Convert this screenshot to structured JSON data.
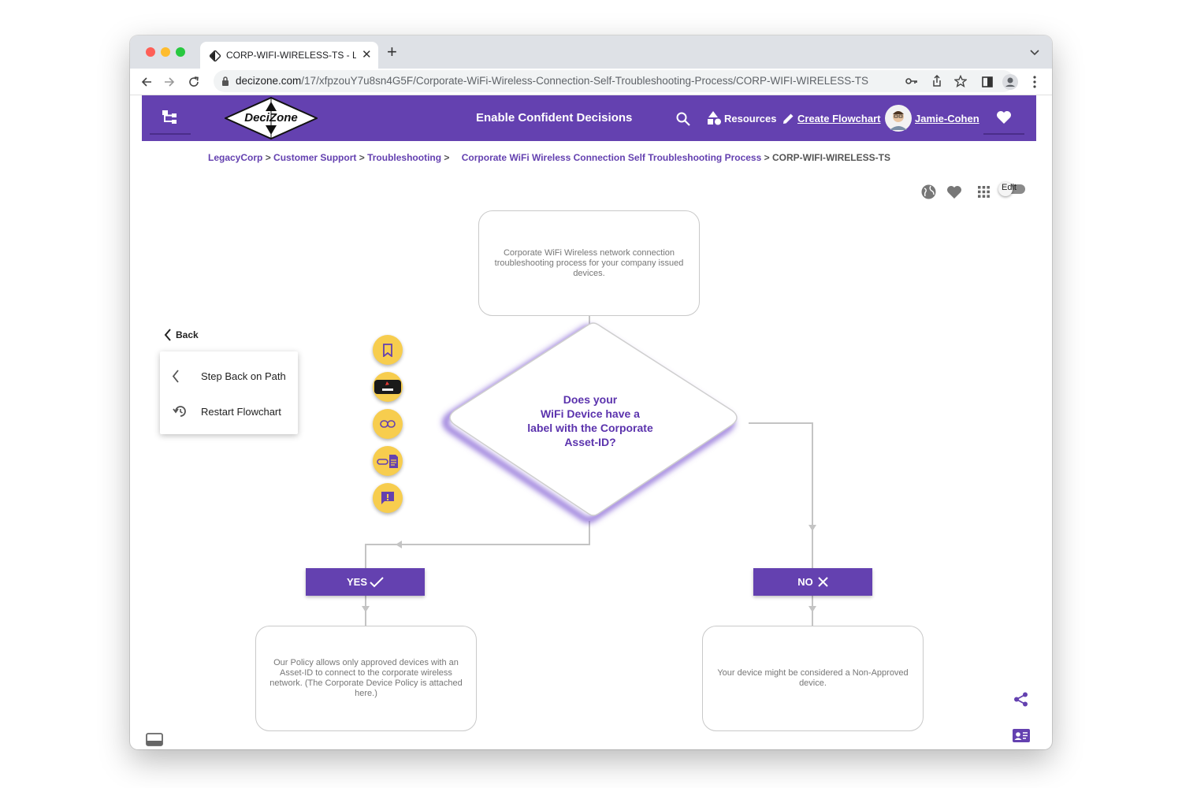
{
  "browser": {
    "tab_title": "CORP-WIFI-WIRELESS-TS - LegacyCorp",
    "url_domain": "decizone.com",
    "url_path": "/17/xfpzouY7u8sn4G5F/Corporate-WiFi-Wireless-Connection-Self-Troubleshooting-Process/CORP-WIFI-WIRELESS-TS",
    "new_tab_label": "+"
  },
  "nav": {
    "logo_text": "DeciZone",
    "tagline": "Enable Confident Decisions",
    "resources_label": "Resources",
    "create_label": "Create Flowchart",
    "user_name": "Jamie-Cohen"
  },
  "breadcrumb": {
    "items": [
      "LegacyCorp",
      "Customer Support",
      "Troubleshooting",
      "Corporate WiFi Wireless Connection Self Troubleshooting Process"
    ],
    "separator": " > ",
    "current": "CORP-WIFI-WIRELESS-TS"
  },
  "toolbar": {
    "edit_label": "Edit"
  },
  "back_menu": {
    "back_label": "Back",
    "step_back_label": "Step Back on Path",
    "restart_label": "Restart Flowchart"
  },
  "flowchart": {
    "start_text": "Corporate WiFi Wireless network connection troubleshooting process for your company issued devices.",
    "question_lines": [
      "Does your",
      "WiFi Device have a",
      "label with the Corporate",
      "Asset-ID?"
    ],
    "yes_label": "YES",
    "no_label": "NO",
    "yes_text": "Our Policy allows only approved devices with an Asset-ID to connect to the corporate wireless network. (The Corporate Device Policy is attached here.)",
    "no_text": "Your device might be considered a Non-Approved device."
  },
  "colors": {
    "brand": "#6441b0",
    "fab": "#f7cd4e"
  }
}
